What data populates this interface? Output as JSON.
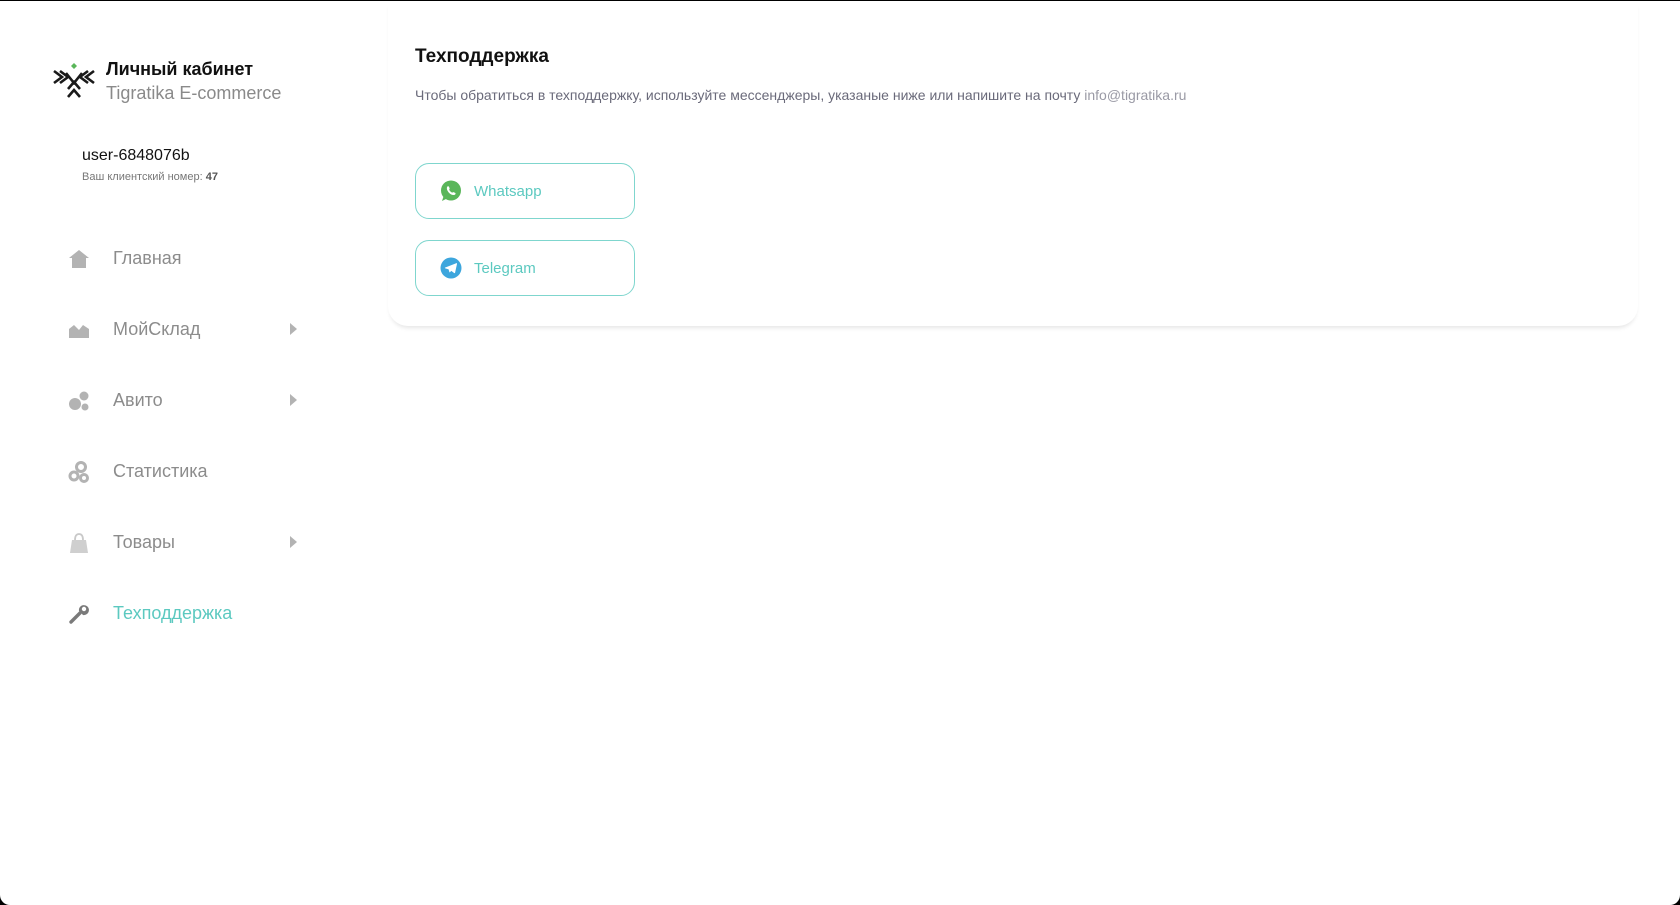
{
  "brand": {
    "title": "Личный кабинет",
    "subtitle": "Tigratika E-commerce",
    "logo": "tigratika-logo"
  },
  "user": {
    "name": "user-6848076b",
    "client_label": "Ваш клиентский номер:",
    "client_number": "47"
  },
  "nav": {
    "items": [
      {
        "label": "Главная",
        "icon": "home-icon",
        "has_submenu": false,
        "active": false
      },
      {
        "label": "МойСклад",
        "icon": "mountains-icon",
        "has_submenu": true,
        "active": false
      },
      {
        "label": "Авито",
        "icon": "circles-icon",
        "has_submenu": true,
        "active": false
      },
      {
        "label": "Статистика",
        "icon": "gears-icon",
        "has_submenu": false,
        "active": false
      },
      {
        "label": "Товары",
        "icon": "bag-icon",
        "has_submenu": true,
        "active": false
      },
      {
        "label": "Техподдержка",
        "icon": "wrench-icon",
        "has_submenu": false,
        "active": true
      }
    ]
  },
  "main": {
    "title": "Техподдержка",
    "description": "Чтобы обратиться в техподдержку, используйте мессенджеры, указаные ниже или напишите на почту",
    "email": "info@tigratika.ru",
    "buttons": [
      {
        "label": "Whatsapp",
        "icon": "whatsapp-icon"
      },
      {
        "label": "Telegram",
        "icon": "telegram-icon"
      }
    ]
  },
  "colors": {
    "accent": "#5cc9c0",
    "button_border": "#7fd6ce",
    "whatsapp": "#5ab65a",
    "telegram": "#3da6dd",
    "nav_text": "#8c8c8c",
    "nav_icon": "#b3b3b3"
  }
}
